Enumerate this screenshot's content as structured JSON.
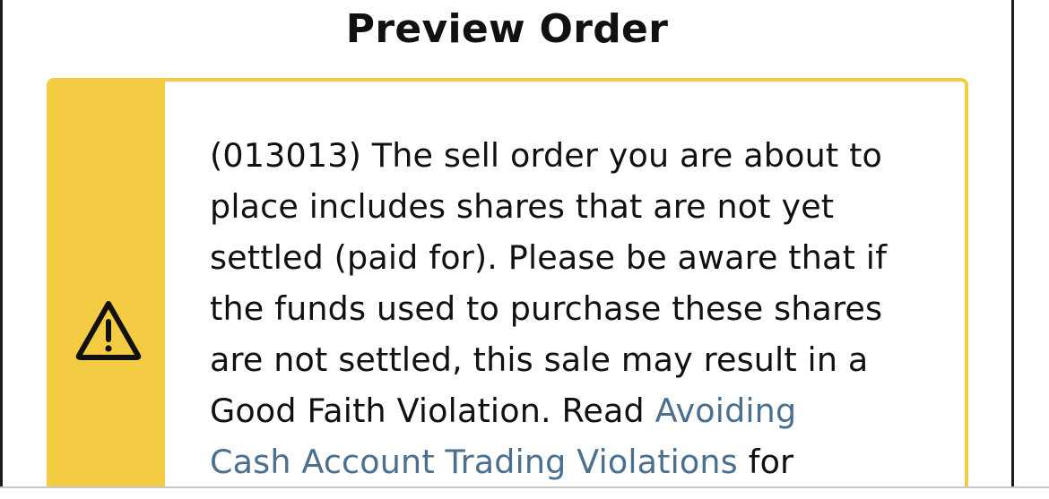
{
  "page": {
    "title": "Preview Order"
  },
  "alert": {
    "icon": "warning-icon",
    "accent_color": "#f4cc44",
    "message_lines": [
      "(013013) The sell order you are about to",
      "place includes shares that are not yet",
      "settled (paid for). Please be aware that if",
      "the funds used to purchase these shares",
      "are not settled, this sale may result in a",
      "Good Faith Violation. Read "
    ],
    "link_line1": "Avoiding",
    "link_line2": "Cash Account Trading Violations",
    "link_color": "#4a6f8f",
    "after_link": " for"
  }
}
